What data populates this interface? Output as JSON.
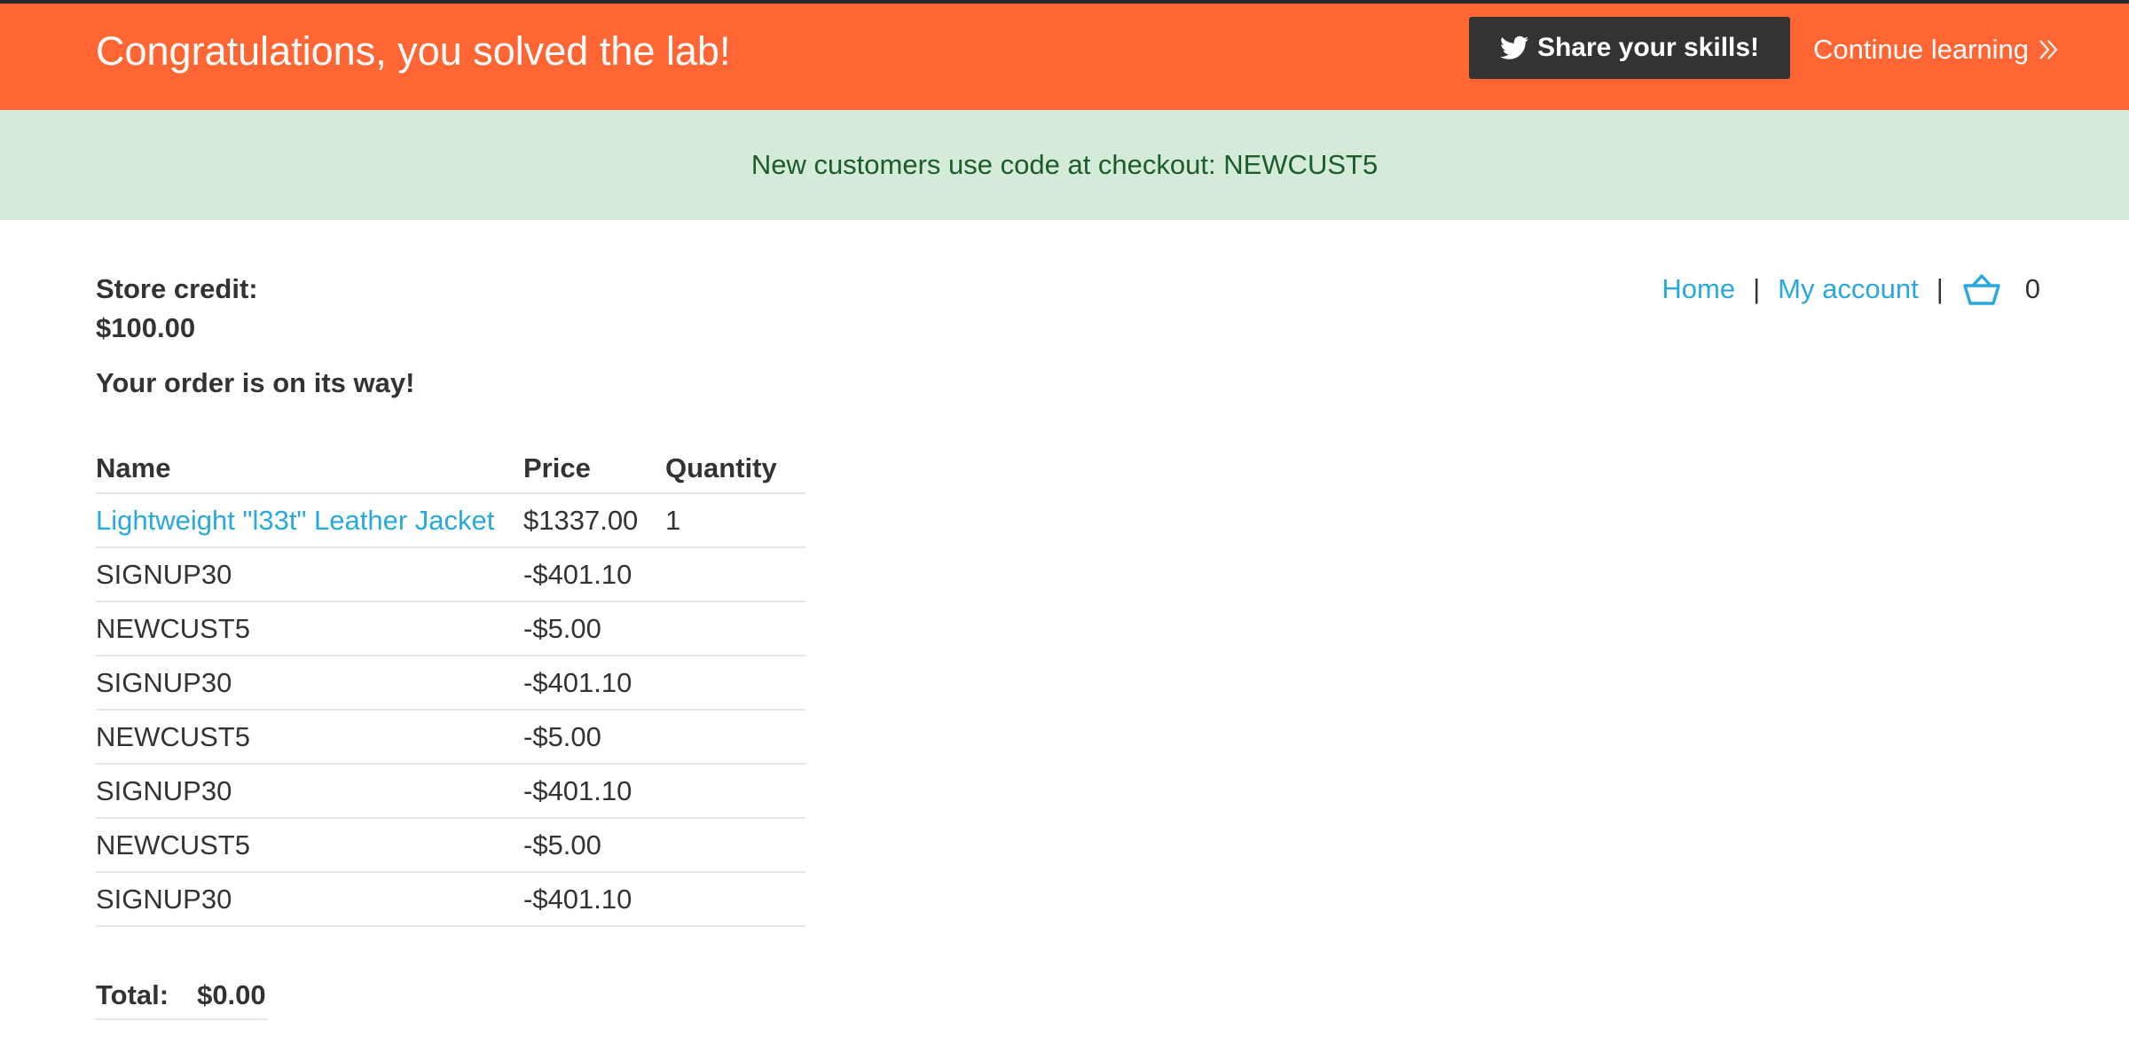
{
  "banner": {
    "title": "Congratulations, you solved the lab!",
    "share_label": "Share your skills!",
    "continue_label": "Continue learning",
    "bg_color": "#ff6633"
  },
  "notice": {
    "text": "New customers use code at checkout: NEWCUST5",
    "bg_color": "#d4ebd9"
  },
  "nav": {
    "home": "Home",
    "separator": "|",
    "my_account": "My account",
    "cart_count": "0"
  },
  "account": {
    "credit_label": "Store credit:",
    "credit_value": "$100.00",
    "order_message": "Your order is on its way!"
  },
  "order": {
    "headers": [
      "Name",
      "Price",
      "Quantity"
    ],
    "rows": [
      {
        "name": "Lightweight \"l33t\" Leather Jacket",
        "price": "$1337.00",
        "quantity": "1",
        "is_link": true
      },
      {
        "name": "SIGNUP30",
        "price": "-$401.10",
        "quantity": ""
      },
      {
        "name": "NEWCUST5",
        "price": "-$5.00",
        "quantity": ""
      },
      {
        "name": "SIGNUP30",
        "price": "-$401.10",
        "quantity": ""
      },
      {
        "name": "NEWCUST5",
        "price": "-$5.00",
        "quantity": ""
      },
      {
        "name": "SIGNUP30",
        "price": "-$401.10",
        "quantity": ""
      },
      {
        "name": "NEWCUST5",
        "price": "-$5.00",
        "quantity": ""
      },
      {
        "name": "SIGNUP30",
        "price": "-$401.10",
        "quantity": ""
      }
    ],
    "total_label": "Total:",
    "total_value": "$0.00"
  },
  "icons": {
    "share": "twitter-icon",
    "continue": "double-chevron-right-icon",
    "cart": "cart-basket-icon"
  },
  "colors": {
    "link": "#29a8dd",
    "text": "#333332"
  }
}
